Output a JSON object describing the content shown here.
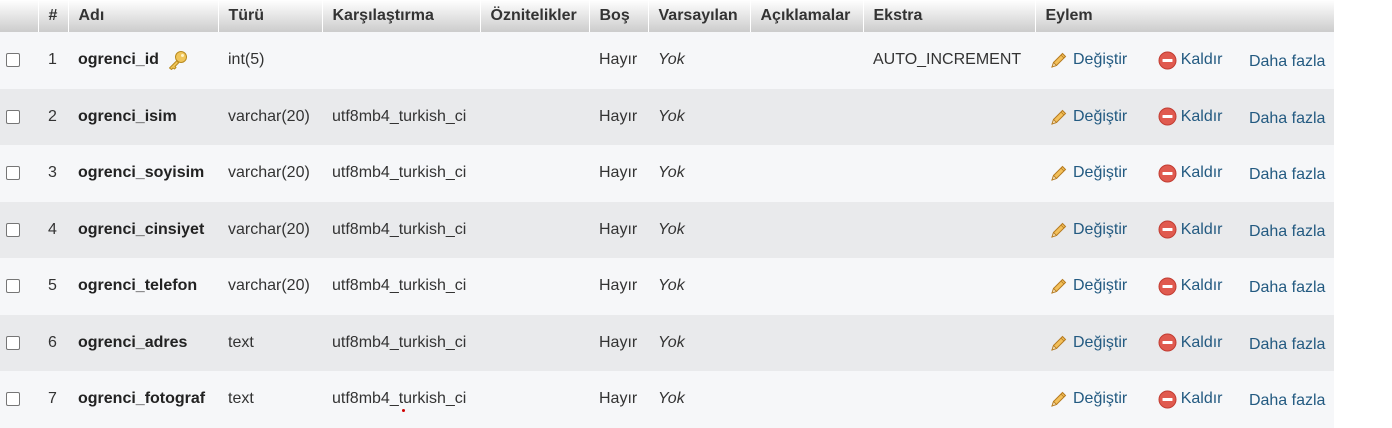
{
  "headers": {
    "num": "#",
    "name": "Adı",
    "type": "Türü",
    "collation": "Karşılaştırma",
    "attributes": "Öznitelikler",
    "null": "Boş",
    "default": "Varsayılan",
    "comments": "Açıklamalar",
    "extra": "Ekstra",
    "action": "Eylem"
  },
  "actions": {
    "change": "Değiştir",
    "drop": "Kaldır",
    "more": "Daha fazla"
  },
  "rows": [
    {
      "num": "1",
      "name": "ogrenci_id",
      "type": "int(5)",
      "collation": "",
      "attributes": "",
      "null": "Hayır",
      "default": "Yok",
      "comments": "",
      "extra": "AUTO_INCREMENT",
      "primary_key": true
    },
    {
      "num": "2",
      "name": "ogrenci_isim",
      "type": "varchar(20)",
      "collation": "utf8mb4_turkish_ci",
      "attributes": "",
      "null": "Hayır",
      "default": "Yok",
      "comments": "",
      "extra": ""
    },
    {
      "num": "3",
      "name": "ogrenci_soyisim",
      "type": "varchar(20)",
      "collation": "utf8mb4_turkish_ci",
      "attributes": "",
      "null": "Hayır",
      "default": "Yok",
      "comments": "",
      "extra": ""
    },
    {
      "num": "4",
      "name": "ogrenci_cinsiyet",
      "type": "varchar(20)",
      "collation": "utf8mb4_turkish_ci",
      "attributes": "",
      "null": "Hayır",
      "default": "Yok",
      "comments": "",
      "extra": ""
    },
    {
      "num": "5",
      "name": "ogrenci_telefon",
      "type": "varchar(20)",
      "collation": "utf8mb4_turkish_ci",
      "attributes": "",
      "null": "Hayır",
      "default": "Yok",
      "comments": "",
      "extra": ""
    },
    {
      "num": "6",
      "name": "ogrenci_adres",
      "type": "text",
      "collation": "utf8mb4_turkish_ci",
      "attributes": "",
      "null": "Hayır",
      "default": "Yok",
      "comments": "",
      "extra": ""
    },
    {
      "num": "7",
      "name": "ogrenci_fotograf",
      "type": "text",
      "collation": "utf8mb4_turkish_ci",
      "attributes": "",
      "null": "Hayır",
      "default": "Yok",
      "comments": "",
      "extra": ""
    }
  ],
  "colors": {
    "link": "#235a81",
    "row_light": "#f6f7f9",
    "row_dark": "#e9eaec",
    "drop_icon": "#e05a4f",
    "key_icon": "#e6b84a",
    "pencil_icon": "#e8a93a"
  },
  "icons": {
    "primary_key": "key-icon",
    "change": "pencil-icon",
    "drop": "drop-circle-icon"
  }
}
